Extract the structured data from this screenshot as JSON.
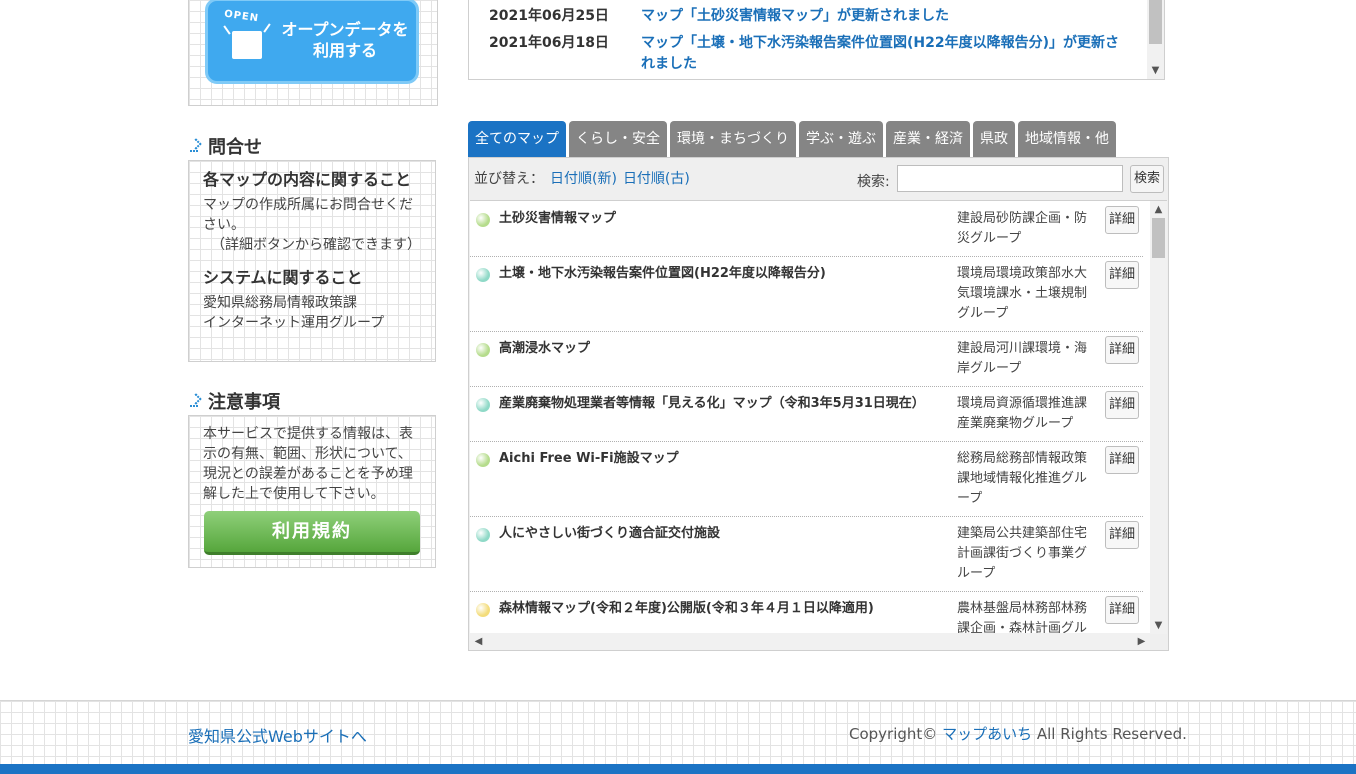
{
  "open_data": {
    "tag": "OPEN",
    "label": "オープンデータを\n利用する"
  },
  "news": [
    {
      "date": "2021年06月25日",
      "text": "マップ「土砂災害情報マップ」が更新されました"
    },
    {
      "date": "2021年06月18日",
      "text": "マップ「土壌・地下水汚染報告案件位置図(H22年度以降報告分)」が更新されました"
    }
  ],
  "contact": {
    "title": "問合せ",
    "h1": "各マップの内容に関すること",
    "p1": "マップの作成所属にお問合せください。",
    "p1b": "（詳細ボタンから確認できます）",
    "h2": "システムに関すること",
    "p2a": "愛知県総務局情報政策課",
    "p2b": "インターネット運用グループ"
  },
  "notice": {
    "title": "注意事項",
    "text": "本サービスで提供する情報は、表示の有無、範囲、形状について、現況との誤差があることを予め理解した上で使用して下さい。",
    "button": "利用規約"
  },
  "tabs": [
    "全てのマップ",
    "くらし・安全",
    "環境・まちづくり",
    "学ぶ・遊ぶ",
    "産業・経済",
    "県政",
    "地域情報・他"
  ],
  "sort": {
    "label": "並び替え：",
    "new": "日付順(新)",
    "old": "日付順(古)"
  },
  "search": {
    "label": "検索:",
    "value": "",
    "button": "検索"
  },
  "maps": [
    {
      "name": "土砂災害情報マップ",
      "dept": "建設局砂防課企画・防災グループ",
      "color": "#b5dc8c",
      "detail": "詳細"
    },
    {
      "name": "土壌・地下水汚染報告案件位置図(H22年度以降報告分)",
      "dept": "環境局環境政策部水大気環境課水・土壌規制グループ",
      "color": "#8fd9c7",
      "detail": "詳細"
    },
    {
      "name": "高潮浸水マップ",
      "dept": "建設局河川課環境・海岸グループ",
      "color": "#b5dc8c",
      "detail": "詳細"
    },
    {
      "name": "産業廃棄物処理業者等情報「見える化」マップ（令和3年5月31日現在）",
      "dept": "環境局資源循環推進課産業廃棄物グループ",
      "color": "#8fd9c7",
      "detail": "詳細"
    },
    {
      "name": "Aichi Free Wi-Fi施設マップ",
      "dept": "総務局総務部情報政策課地域情報化推進グループ",
      "color": "#b5dc8c",
      "detail": "詳細"
    },
    {
      "name": "人にやさしい街づくり適合証交付施設",
      "dept": "建築局公共建築部住宅計画課街づくり事業グループ",
      "color": "#8fd9c7",
      "detail": "詳細"
    },
    {
      "name": "森林情報マップ(令和２年度)公開版(令和３年４月１日以降適用)",
      "dept": "農林基盤局林務部林務課企画・森林計画グループ",
      "color": "#f3dc7a",
      "detail": "詳細"
    }
  ],
  "footer": {
    "left_link": "愛知県公式Webサイトへ",
    "copyright_prefix": "Copyright©",
    "brand": "マップあいち",
    "copyright_suffix": "All Rights Reserved."
  }
}
